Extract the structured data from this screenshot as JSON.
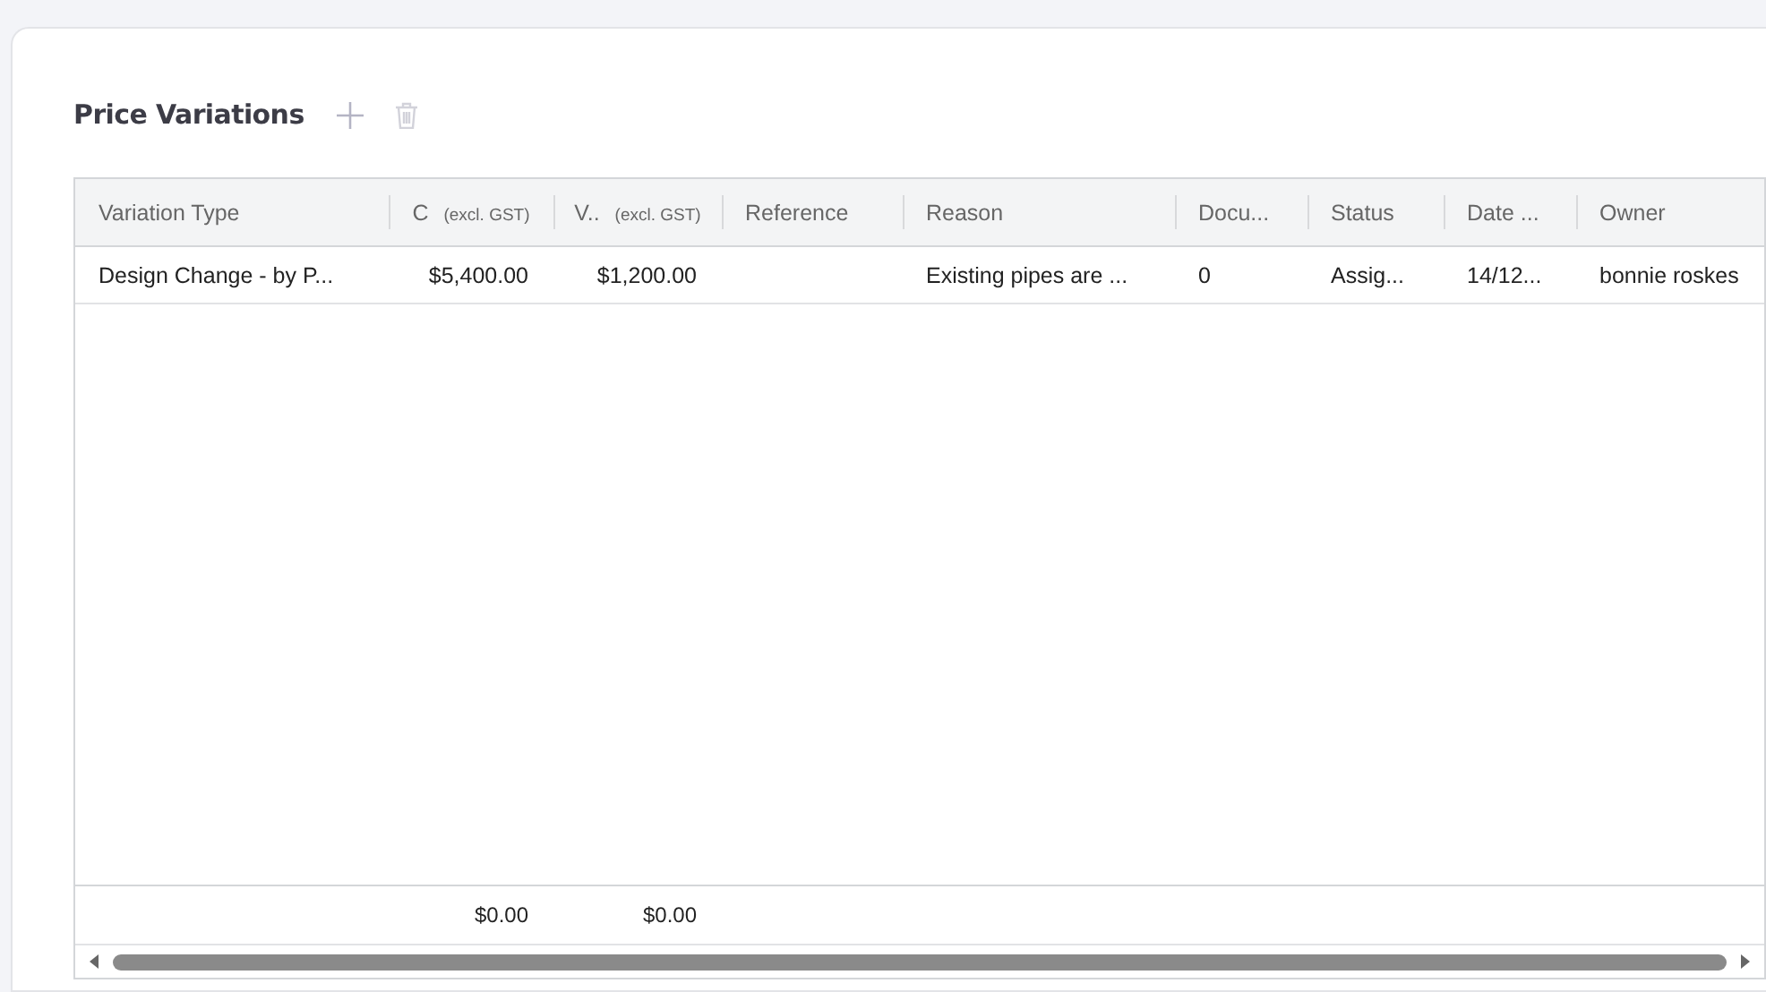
{
  "panel": {
    "title": "Price Variations"
  },
  "table": {
    "columns": [
      {
        "label": "Variation Type",
        "kind": "text"
      },
      {
        "label": "C",
        "note": "(excl. GST)",
        "kind": "amount",
        "total": "$0.00"
      },
      {
        "label": "V..",
        "note": "(excl. GST)",
        "kind": "amount",
        "total": "$0.00"
      },
      {
        "label": "Reference",
        "kind": "text"
      },
      {
        "label": "Reason",
        "kind": "text"
      },
      {
        "label": "Docu...",
        "kind": "text"
      },
      {
        "label": "Status",
        "kind": "text"
      },
      {
        "label": "Date ...",
        "kind": "text"
      },
      {
        "label": "Owner",
        "kind": "text"
      }
    ],
    "rows": [
      [
        "Design Change - by P...",
        "$5,400.00",
        "$1,200.00",
        null,
        "Existing pipes are ...",
        "0",
        "Assig...",
        "14/12...",
        "bonnie roskes"
      ]
    ]
  }
}
